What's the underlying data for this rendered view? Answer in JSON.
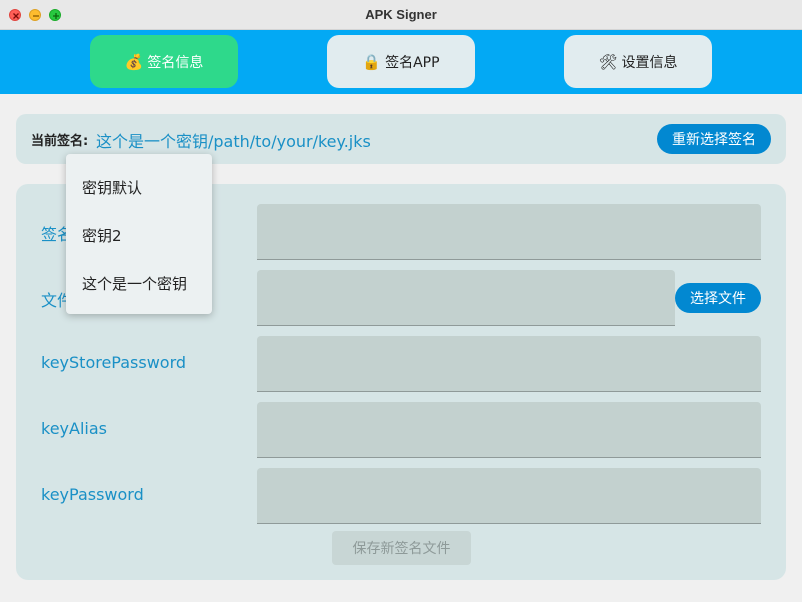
{
  "window": {
    "title": "APK Signer"
  },
  "tabs": [
    {
      "icon": "💰",
      "label": "签名信息"
    },
    {
      "icon": "🔒",
      "label": "签名APP"
    },
    {
      "icon": "🛠",
      "label": "设置信息"
    }
  ],
  "signature": {
    "label": "当前签名:",
    "value": "这个是一个密钥/path/to/your/key.jks",
    "reselect_label": "重新选择签名"
  },
  "form": {
    "fields": [
      {
        "label": "签名名称",
        "value": ""
      },
      {
        "label": "文件路径",
        "value": ""
      },
      {
        "label": "keyStorePassword",
        "value": ""
      },
      {
        "label": "keyAlias",
        "value": ""
      },
      {
        "label": "keyPassword",
        "value": ""
      }
    ],
    "choose_file_label": "选择文件",
    "save_label": "保存新签名文件"
  },
  "dropdown": {
    "items": [
      "密钥默认",
      "密钥2",
      "这个是一个密钥"
    ]
  },
  "colors": {
    "accent": "#03a9f4",
    "active_tab": "#2ed98b",
    "button": "#0288d1",
    "label": "#1a90c6"
  }
}
